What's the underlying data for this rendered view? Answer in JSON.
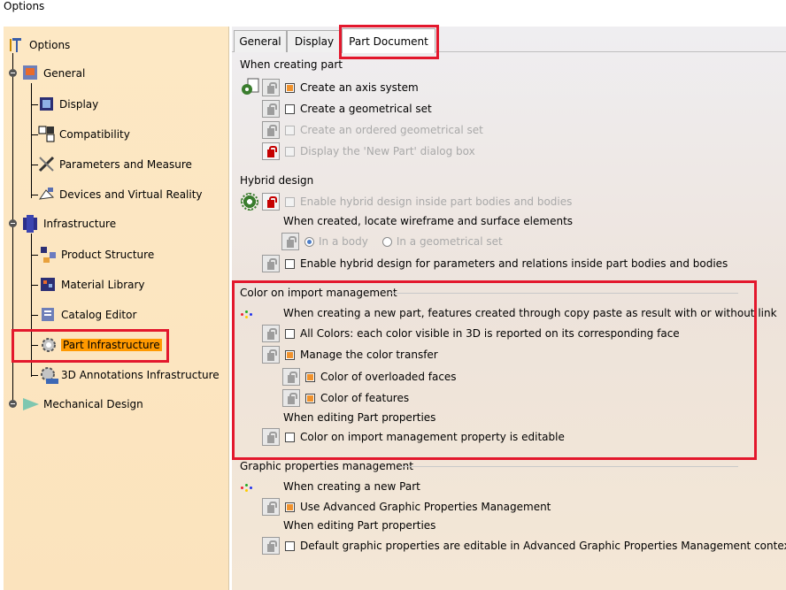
{
  "window": {
    "title": "Options"
  },
  "tree": {
    "root": {
      "label": "Options"
    },
    "items": [
      {
        "label": "General"
      },
      {
        "label": "Display"
      },
      {
        "label": "Compatibility"
      },
      {
        "label": "Parameters and Measure"
      },
      {
        "label": "Devices and Virtual Reality"
      },
      {
        "label": "Infrastructure"
      },
      {
        "label": "Product Structure"
      },
      {
        "label": "Material Library"
      },
      {
        "label": "Catalog Editor"
      },
      {
        "label": "Part Infrastructure"
      },
      {
        "label": "3D Annotations Infrastructure"
      },
      {
        "label": "Mechanical Design"
      }
    ]
  },
  "tabs": [
    {
      "label": "General"
    },
    {
      "label": "Display"
    },
    {
      "label": "Part Document"
    }
  ],
  "creating_part": {
    "title": "When creating part",
    "create_axis": "Create an axis system",
    "create_geo_set": "Create a geometrical set",
    "create_ordered": "Create an ordered geometrical set",
    "display_dialog": "Display the 'New Part' dialog box"
  },
  "hybrid": {
    "title": "Hybrid design",
    "enable_hybrid": "Enable hybrid design inside part bodies and bodies",
    "locate_label": "When created, locate wireframe and surface elements",
    "in_body": "In a body",
    "in_geo_set": "In a geometrical set",
    "enable_params": "Enable hybrid design for parameters and relations inside part bodies and bodies"
  },
  "color_import": {
    "title": "Color on import management",
    "desc": "When creating a new part, features created through copy paste as result with or without link",
    "all_colors": "All Colors: each color visible in 3D is reported on its corresponding face",
    "manage": "Manage the color transfer",
    "overloaded": "Color of overloaded faces",
    "features": "Color of features",
    "editing_label": "When editing Part properties",
    "editable": "Color on import management property is editable"
  },
  "graphic": {
    "title": "Graphic properties management",
    "creating_label": "When creating a new Part",
    "use_advanced": "Use Advanced Graphic Properties Management",
    "editing_label": "When editing Part properties",
    "default_editable": "Default graphic properties are editable in Advanced Graphic Properties Management context"
  },
  "colors": {
    "highlight": "#e3182d",
    "selected": "#ff9900",
    "check": "#f0922d"
  }
}
